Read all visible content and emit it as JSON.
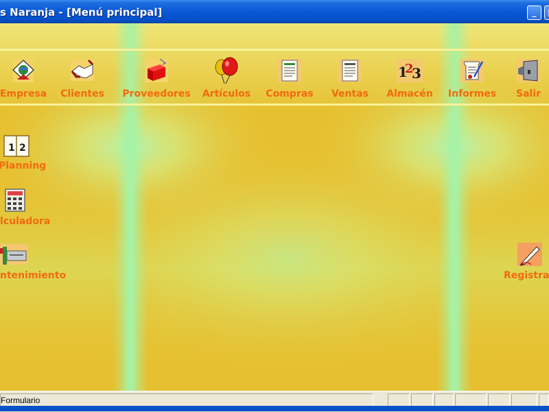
{
  "window": {
    "title": "s Naranja - [Menú principal]",
    "minimize_glyph": "_",
    "maximize_glyph": "□"
  },
  "toolbar": {
    "items": [
      {
        "label": "Empresa",
        "icon": "company-icon"
      },
      {
        "label": "Clientes",
        "icon": "handshake-icon"
      },
      {
        "label": "Proveedores",
        "icon": "supplier-box-icon"
      },
      {
        "label": "Artículos",
        "icon": "balloons-icon"
      },
      {
        "label": "Compras",
        "icon": "purchase-document-icon"
      },
      {
        "label": "Ventas",
        "icon": "sales-document-icon"
      },
      {
        "label": "Almacén",
        "icon": "numbers-123-icon"
      },
      {
        "label": "Informes",
        "icon": "report-icon"
      },
      {
        "label": "Salir",
        "icon": "exit-door-icon"
      }
    ]
  },
  "side": {
    "planning": {
      "label": "Planning",
      "icon": "calendar-12-icon"
    },
    "calculadora": {
      "label": "lculadora",
      "icon": "calculator-icon"
    },
    "mantenimiento": {
      "label": "ntenimiento",
      "icon": "tools-icon"
    },
    "registrar": {
      "label": "Registrar",
      "icon": "pen-sign-icon"
    }
  },
  "status": {
    "text": "Formulario"
  },
  "colors": {
    "label_orange": "#f26a10",
    "background_yellow": "#e8c234",
    "glow_green": "#9ef5a8",
    "titlebar_blue": "#0a58d6"
  }
}
